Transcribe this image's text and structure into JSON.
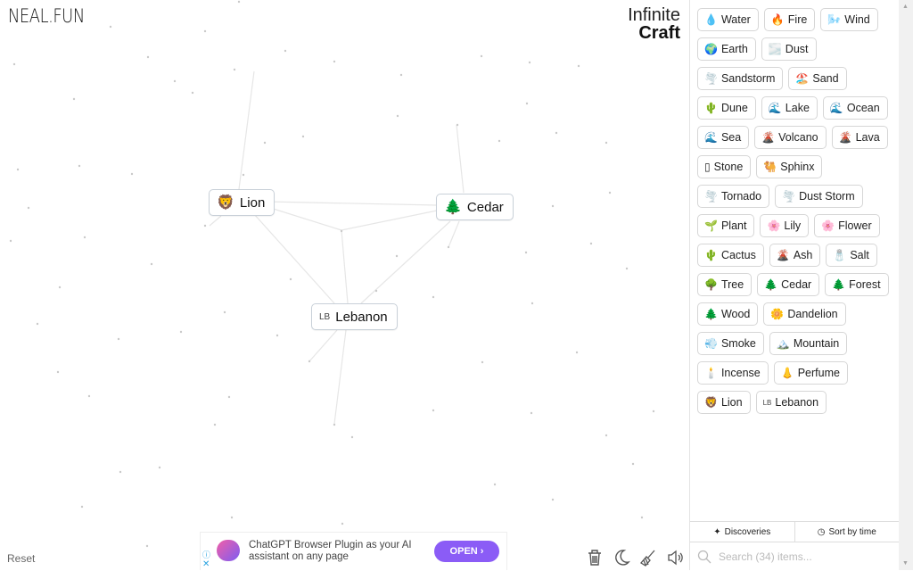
{
  "brand": {
    "logo": "NEAL.FUN",
    "title_line1": "Infinite",
    "title_line2": "Craft"
  },
  "canvas": {
    "nodes": [
      {
        "name": "Lion",
        "emoji": "🦁"
      },
      {
        "name": "Cedar",
        "emoji": "🌲"
      },
      {
        "name": "Lebanon",
        "emoji": "LB"
      }
    ]
  },
  "footer": {
    "reset_label": "Reset",
    "tools": [
      "trash-icon",
      "moon-icon",
      "broom-icon",
      "speaker-icon"
    ]
  },
  "ad": {
    "text": "ChatGPT Browser Plugin as your AI assistant on any page",
    "button": "OPEN ›",
    "info": "ⓘ",
    "close": "✕"
  },
  "sidebar": {
    "items": [
      {
        "emoji": "💧",
        "label": "Water"
      },
      {
        "emoji": "🔥",
        "label": "Fire"
      },
      {
        "emoji": "🌬️",
        "label": "Wind"
      },
      {
        "emoji": "🌍",
        "label": "Earth"
      },
      {
        "emoji": "🌫️",
        "label": "Dust"
      },
      {
        "emoji": "🌪️",
        "label": "Sandstorm"
      },
      {
        "emoji": "🏖️",
        "label": "Sand"
      },
      {
        "emoji": "🌵",
        "label": "Dune"
      },
      {
        "emoji": "🌊",
        "label": "Lake"
      },
      {
        "emoji": "🌊",
        "label": "Ocean"
      },
      {
        "emoji": "🌊",
        "label": "Sea"
      },
      {
        "emoji": "🌋",
        "label": "Volcano"
      },
      {
        "emoji": "🌋",
        "label": "Lava"
      },
      {
        "emoji": "▯",
        "label": "Stone"
      },
      {
        "emoji": "🐫",
        "label": "Sphinx"
      },
      {
        "emoji": "🌪️",
        "label": "Tornado"
      },
      {
        "emoji": "🌪️",
        "label": "Dust Storm"
      },
      {
        "emoji": "🌱",
        "label": "Plant"
      },
      {
        "emoji": "🌸",
        "label": "Lily"
      },
      {
        "emoji": "🌸",
        "label": "Flower"
      },
      {
        "emoji": "🌵",
        "label": "Cactus"
      },
      {
        "emoji": "🌋",
        "label": "Ash"
      },
      {
        "emoji": "🧂",
        "label": "Salt"
      },
      {
        "emoji": "🌳",
        "label": "Tree"
      },
      {
        "emoji": "🌲",
        "label": "Cedar"
      },
      {
        "emoji": "🌲",
        "label": "Forest"
      },
      {
        "emoji": "🌲",
        "label": "Wood"
      },
      {
        "emoji": "🌼",
        "label": "Dandelion"
      },
      {
        "emoji": "💨",
        "label": "Smoke"
      },
      {
        "emoji": "🏔️",
        "label": "Mountain"
      },
      {
        "emoji": "🕯️",
        "label": "Incense"
      },
      {
        "emoji": "👃",
        "label": "Perfume"
      },
      {
        "emoji": "🦁",
        "label": "Lion"
      },
      {
        "emoji": "LB",
        "label": "Lebanon"
      }
    ],
    "tabs": {
      "discoveries": "Discoveries",
      "sort": "Sort by time"
    },
    "search_placeholder": "Search (34) items..."
  }
}
